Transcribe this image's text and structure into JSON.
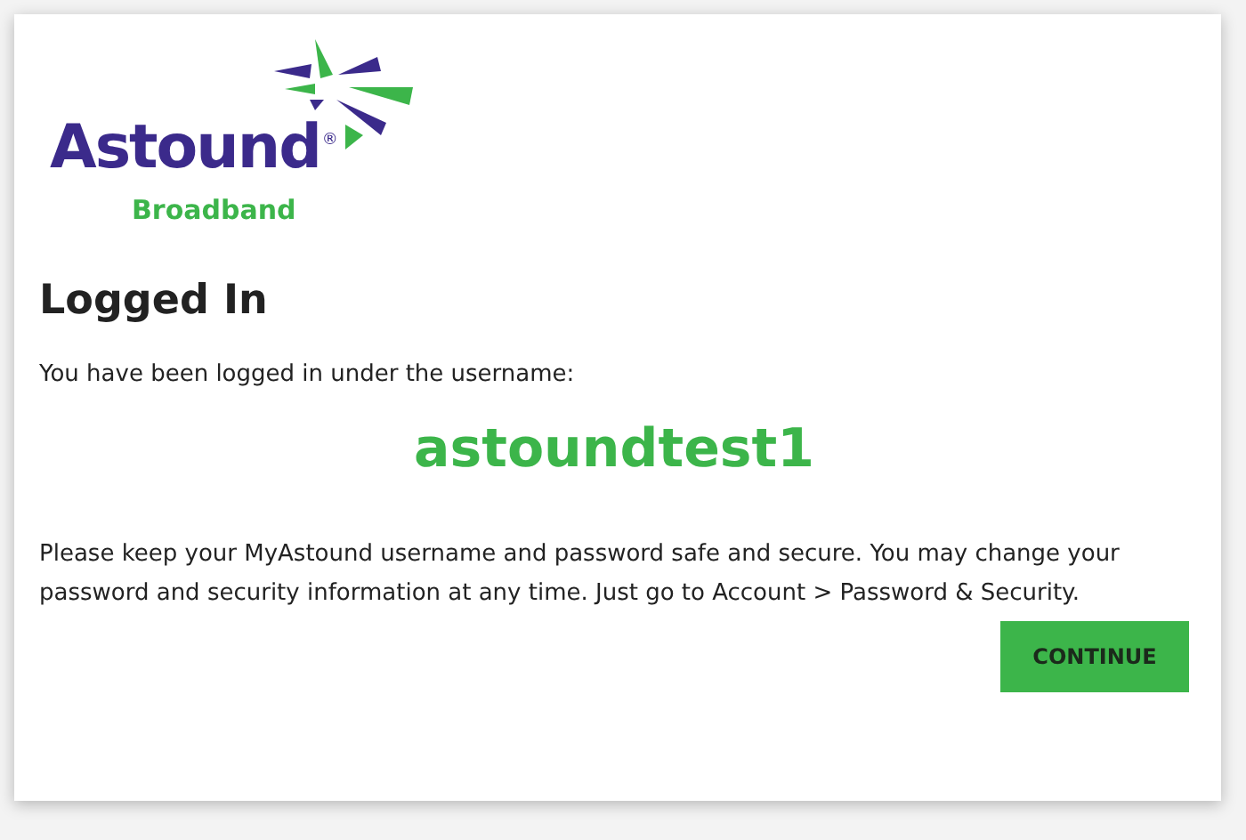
{
  "logo": {
    "name": "Astound",
    "registered": "®",
    "tagline": "Broadband"
  },
  "heading": "Logged In",
  "intro": "You have been logged in under the username:",
  "username": "astoundtest1",
  "message": "Please keep your MyAstound username and password safe and secure. You may change your password and security information at any time. Just go to Account > Password & Security.",
  "button": "CONTINUE"
}
